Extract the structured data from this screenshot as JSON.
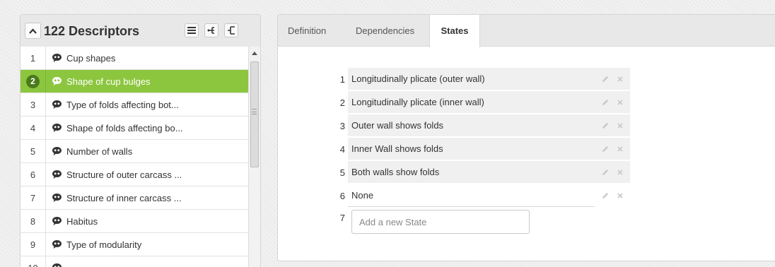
{
  "descriptors": {
    "title": "122 Descriptors",
    "items": [
      {
        "num": "1",
        "label": "Cup shapes",
        "selected": false
      },
      {
        "num": "2",
        "label": "Shape of cup bulges",
        "selected": true
      },
      {
        "num": "3",
        "label": "Type of folds affecting bot...",
        "selected": false
      },
      {
        "num": "4",
        "label": "Shape of folds affecting bo...",
        "selected": false
      },
      {
        "num": "5",
        "label": "Number of walls",
        "selected": false
      },
      {
        "num": "6",
        "label": "Structure of outer carcass ...",
        "selected": false
      },
      {
        "num": "7",
        "label": "Structure of inner carcass ...",
        "selected": false
      },
      {
        "num": "8",
        "label": "Habitus",
        "selected": false
      },
      {
        "num": "9",
        "label": "Type of modularity",
        "selected": false
      },
      {
        "num": "10",
        "label": "",
        "selected": false
      }
    ]
  },
  "tabs": [
    {
      "label": "Definition",
      "active": false
    },
    {
      "label": "Dependencies",
      "active": false
    },
    {
      "label": "States",
      "active": true
    }
  ],
  "states": [
    {
      "num": "1",
      "label": "Longitudinally plicate (outer wall)"
    },
    {
      "num": "2",
      "label": "Longitudinally plicate (inner wall)"
    },
    {
      "num": "3",
      "label": "Outer wall shows folds"
    },
    {
      "num": "4",
      "label": "Inner Wall shows folds"
    },
    {
      "num": "5",
      "label": "Both walls show folds"
    },
    {
      "num": "6",
      "label": "None"
    }
  ],
  "new_state": {
    "num": "7",
    "placeholder": "Add a new State"
  },
  "colors": {
    "selected_row": "#8cc63f",
    "selected_badge": "#4a7b1b"
  }
}
